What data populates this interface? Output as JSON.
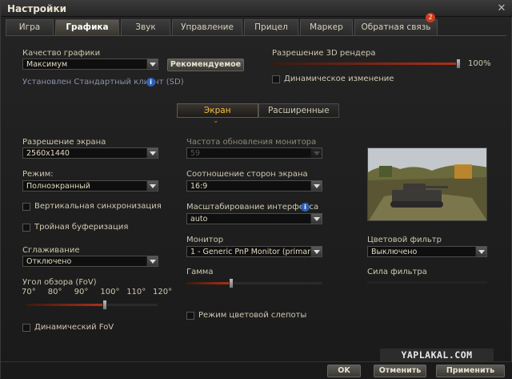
{
  "window": {
    "title": "Настройки",
    "close_icon": "close-icon"
  },
  "tabs": [
    {
      "label": "Игра"
    },
    {
      "label": "Графика",
      "active": true
    },
    {
      "label": "Звук"
    },
    {
      "label": "Управление"
    },
    {
      "label": "Прицел"
    },
    {
      "label": "Маркер"
    },
    {
      "label": "Обратная связь",
      "badge": "2"
    }
  ],
  "graphics": {
    "quality_label": "Качество графики",
    "quality_value": "Максимум",
    "recommended_button": "Рекомендуемое",
    "client_info": "Установлен Стандартный клиент (SD)",
    "render_res_label": "Разрешение 3D рендера",
    "render_res_value": "100%",
    "render_res_level": 1.0,
    "dynamic_change_label": "Динамическое изменение"
  },
  "subtabs": {
    "screen": "Экран",
    "advanced": "Расширенные"
  },
  "left": {
    "resolution_label": "Разрешение экрана",
    "resolution_value": "2560x1440",
    "mode_label": "Режим:",
    "mode_value": "Полноэкранный",
    "vsync_label": "Вертикальная синхронизация",
    "triple_label": "Тройная буферизация",
    "aa_label": "Сглаживание",
    "aa_value": "Отключено",
    "fov_label": "Угол обзора (FoV)",
    "fov_ticks": [
      "70°",
      "80°",
      "90°",
      "100°",
      "110°",
      "120°"
    ],
    "fov_value": 100,
    "dynamic_fov_label": "Динамический FoV"
  },
  "middle": {
    "refresh_label": "Частота обновления монитора",
    "refresh_value": "59",
    "aspect_label": "Соотношение сторон экрана",
    "aspect_value": "16:9",
    "ui_scale_label": "Масштабирование интерфейса",
    "ui_scale_value": "auto",
    "monitor_label": "Монитор",
    "monitor_value": "1 - Generic PnP Monitor (primary)",
    "gamma_label": "Гамма",
    "gamma_level": 0.33,
    "colorblind_label": "Режим цветовой слепоты"
  },
  "right": {
    "color_filter_label": "Цветовой фильтр",
    "color_filter_value": "Выключено",
    "filter_strength_label": "Сила фильтра",
    "filter_strength_level": 0
  },
  "footer": {
    "ok": "OK",
    "cancel": "Отменить",
    "apply": "Применить",
    "watermark": "YAPLAKAL.COM"
  },
  "colors": {
    "accent": "#b0301a",
    "active_subtab": "#f5c040"
  }
}
